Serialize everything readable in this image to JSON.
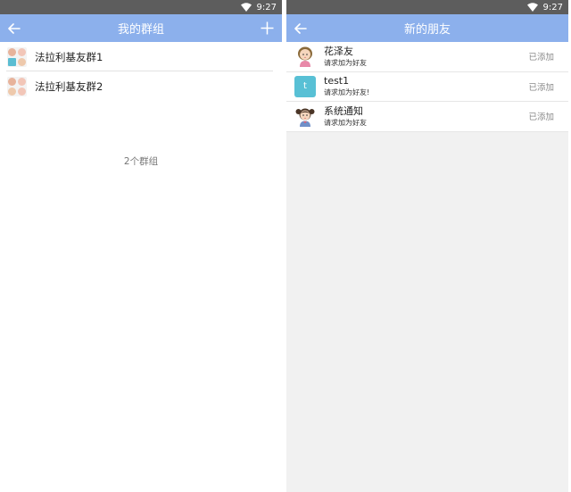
{
  "status_bar": {
    "time": "9:27"
  },
  "left_screen": {
    "title": "我的群组",
    "groups": [
      {
        "name": "法拉利基友群1"
      },
      {
        "name": "法拉利基友群2"
      }
    ],
    "count_text": "2个群组"
  },
  "right_screen": {
    "title": "新的朋友",
    "requests": [
      {
        "name": "花泽友",
        "message": "请求加为好友",
        "status": "已添加",
        "avatar": "girl-avatar"
      },
      {
        "name": "test1",
        "message": "请求加为好友!",
        "status": "已添加",
        "avatar_letter": "t"
      },
      {
        "name": "系统通知",
        "message": "请求加为好友",
        "status": "已添加",
        "avatar": "girl-pigtails-avatar"
      }
    ]
  },
  "colors": {
    "app_bar": "#8cb0ec",
    "status_bar": "#5d5d5d",
    "letter_avatar": "#58c0d5",
    "right_bg": "#f1f1f1"
  },
  "icons": {
    "back": "arrow-left-icon",
    "add": "plus-icon",
    "wifi": "wifi-icon"
  }
}
